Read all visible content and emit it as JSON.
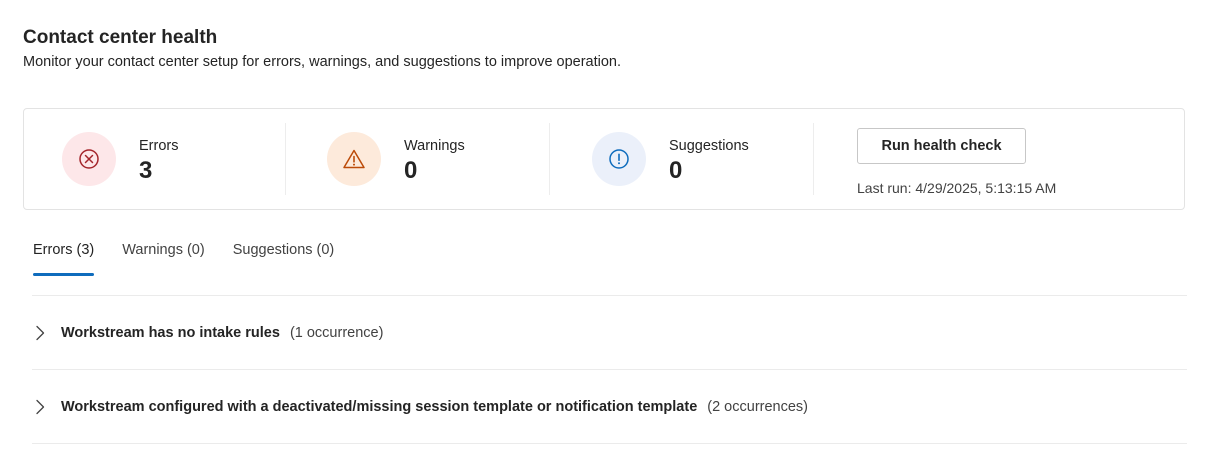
{
  "header": {
    "title": "Contact center health",
    "subtitle": "Monitor your contact center setup for errors, warnings, and suggestions to improve operation."
  },
  "summary": {
    "stats": [
      {
        "label": "Errors",
        "value": "3",
        "icon": "error-circle-icon",
        "icon_color": "#a4262c",
        "bg_color": "#fde7e9"
      },
      {
        "label": "Warnings",
        "value": "0",
        "icon": "warning-triangle-icon",
        "icon_color": "#bc4b09",
        "bg_color": "#fdeadb"
      },
      {
        "label": "Suggestions",
        "value": "0",
        "icon": "info-circle-icon",
        "icon_color": "#0f6cbd",
        "bg_color": "#ebf0fa"
      }
    ],
    "run_button_label": "Run health check",
    "last_run": "Last run: 4/29/2025, 5:13:15 AM"
  },
  "tabs": [
    {
      "label": "Errors (3)",
      "active": true
    },
    {
      "label": "Warnings (0)",
      "active": false
    },
    {
      "label": "Suggestions (0)",
      "active": false
    }
  ],
  "issues": [
    {
      "title": "Workstream has no intake rules",
      "count": "(1 occurrence)"
    },
    {
      "title": "Workstream configured with a deactivated/missing session template or notification template",
      "count": "(2 occurrences)"
    }
  ],
  "colors": {
    "accent": "#0f6cbd"
  }
}
